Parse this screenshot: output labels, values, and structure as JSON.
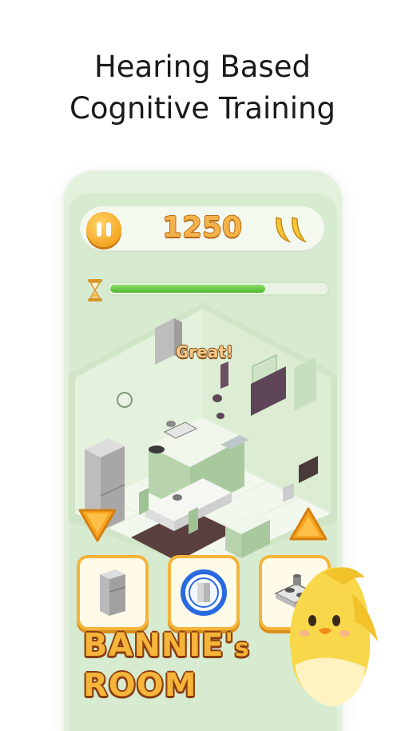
{
  "headline": {
    "line1": "Hearing Based",
    "line2": "Cognitive Training"
  },
  "game": {
    "score": "1250",
    "lives_icon": "banana-icon",
    "progress": 0.72,
    "feedback": "Great!",
    "choices": [
      {
        "icon": "refrigerator-icon"
      },
      {
        "icon": "washing-machine-icon"
      },
      {
        "icon": "gas-stove-icon"
      }
    ]
  },
  "logo": {
    "line1_main": "BANNIE'",
    "line1_small": "s",
    "line2": "ROOM"
  },
  "colors": {
    "accent": "#f5b43a",
    "progress": "#4fb52e",
    "background": "#d7ebd1"
  }
}
